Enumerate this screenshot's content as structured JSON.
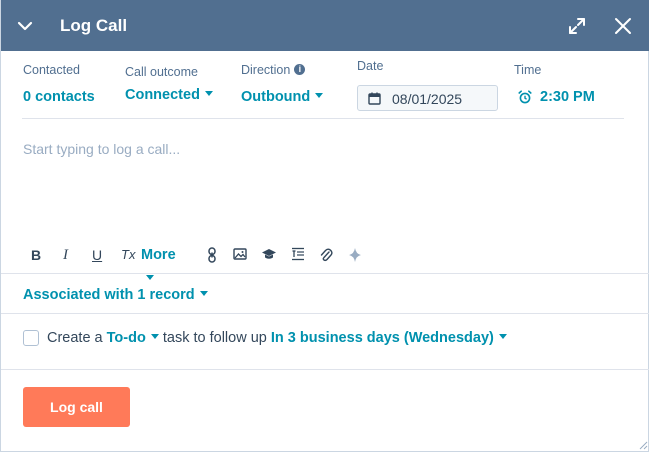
{
  "header": {
    "title": "Log Call",
    "collapse_icon": "chevron-down-icon",
    "expand_icon": "expand-icon",
    "close_icon": "close-icon",
    "background": "#516f90"
  },
  "meta": {
    "contacted": {
      "label": "Contacted",
      "value": "0 contacts"
    },
    "outcome": {
      "label": "Call outcome",
      "value": "Connected"
    },
    "direction": {
      "label": "Direction",
      "value": "Outbound",
      "info_icon": "i"
    },
    "date": {
      "label": "Date",
      "value": "08/01/2025"
    },
    "time": {
      "label": "Time",
      "value": "2:30 PM"
    }
  },
  "editor": {
    "placeholder": "Start typing to log a call..."
  },
  "toolbar": {
    "bold": "B",
    "italic": "I",
    "underline": "U",
    "clear_format": "Tx",
    "more": "More"
  },
  "associations": {
    "label": "Associated with 1 record"
  },
  "task": {
    "prefix": "Create a",
    "type": "To-do",
    "middle": "task to follow up",
    "due": "In 3 business days (Wednesday)"
  },
  "footer": {
    "log_button": "Log call",
    "button_color": "#ff7a59"
  },
  "colors": {
    "accent": "#0091ae",
    "text": "#33475b"
  }
}
